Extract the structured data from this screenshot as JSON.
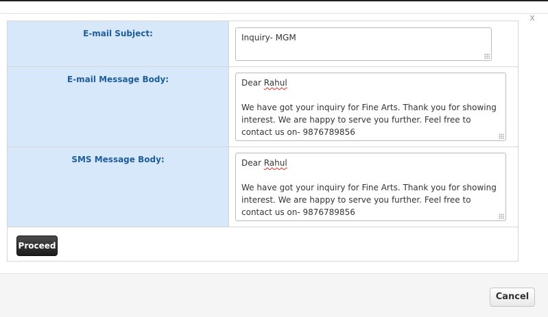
{
  "dialog": {
    "close_label": "x"
  },
  "form": {
    "email_subject": {
      "label": "E-mail Subject:",
      "value": "Inquiry- MGM"
    },
    "email_body": {
      "label": "E-mail Message Body:",
      "greeting_prefix": "Dear ",
      "greeting_name": "Rahul",
      "body": "We have got your inquiry for Fine Arts. Thank you for showing interest. We are happy to serve you further. Feel free to contact us on- 9876789856"
    },
    "sms_body": {
      "label": "SMS Message Body:",
      "greeting_prefix": "Dear ",
      "greeting_name": "Rahul",
      "body": "We have got your inquiry for Fine Arts. Thank you for showing interest. We are happy to serve you further. Feel free to contact us on- 9876789856"
    },
    "proceed_label": "Proceed"
  },
  "footer": {
    "cancel_label": "Cancel"
  }
}
